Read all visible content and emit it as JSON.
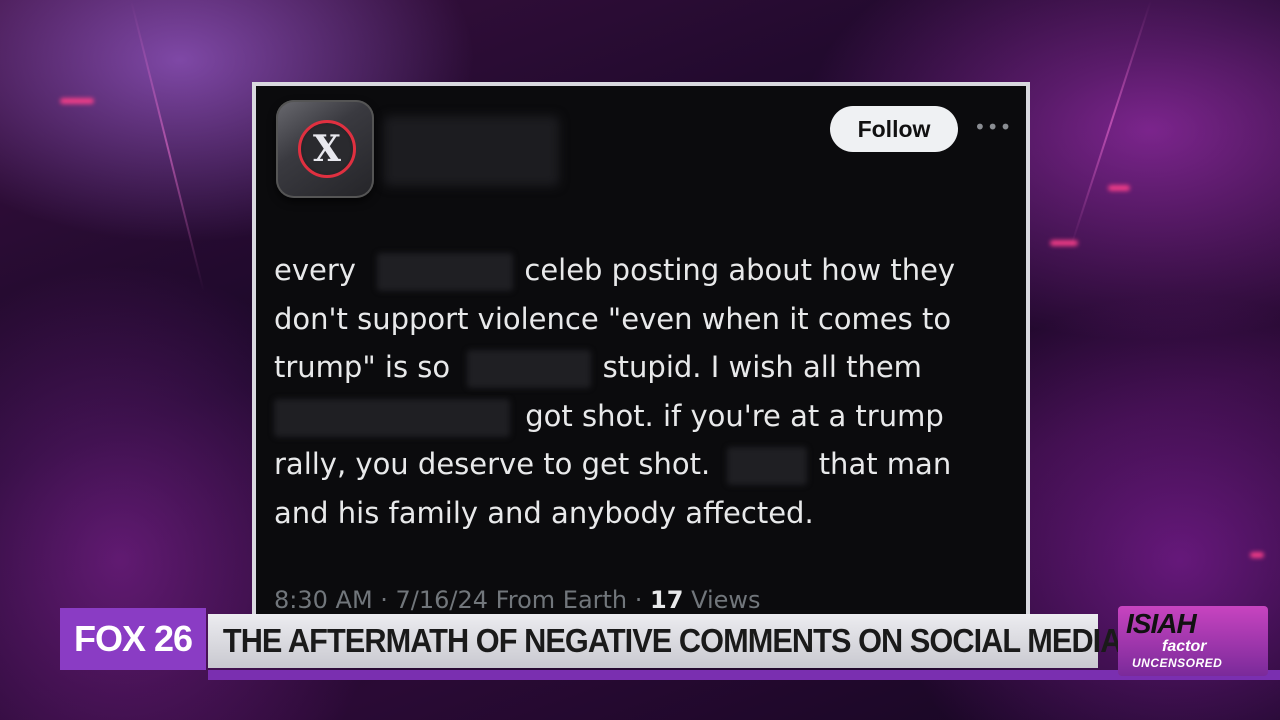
{
  "post": {
    "follow_label": "Follow",
    "more_label": "•••",
    "avatar_glyph": "X",
    "lines": [
      [
        "every",
        "celeb posting about how they"
      ],
      [
        "don't support violence \"even when it comes to"
      ],
      [
        "trump\" is so",
        "stupid. I wish all them"
      ],
      [
        "got shot. if you're at a trump"
      ],
      [
        "rally, you deserve to get shot.",
        "that man"
      ],
      [
        "and his family and anybody affected."
      ]
    ],
    "meta_time": "8:30 AM · 7/16/24 From Earth · ",
    "meta_views_count": "17",
    "meta_views_label": " Views"
  },
  "lower_third": {
    "station": "FOX 26",
    "headline": "THE AFTERMATH OF NEGATIVE COMMENTS ON SOCIAL MEDIA",
    "show_logo": {
      "line1": "ISIAH",
      "line2": "factor",
      "line3": "UNCENSORED"
    }
  },
  "colors": {
    "accent_purple": "#8a3cc4",
    "x_ring_red": "#e03040",
    "post_bg": "#0b0b0d"
  }
}
